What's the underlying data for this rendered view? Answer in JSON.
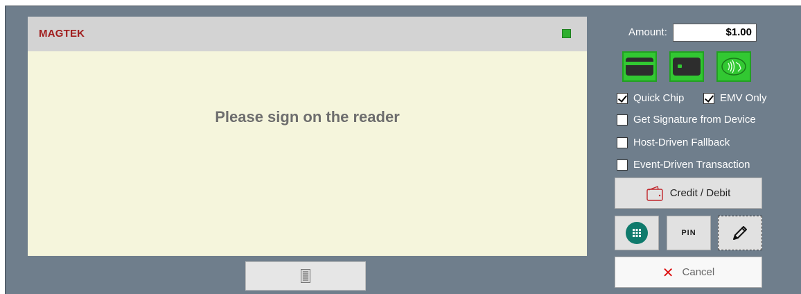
{
  "display": {
    "brand": "MAGTEK",
    "message": "Please sign on the reader",
    "status_color": "#2eaf2e"
  },
  "amount": {
    "label": "Amount:",
    "value": "$1.00"
  },
  "readers": [
    {
      "name": "swipe-card-icon"
    },
    {
      "name": "chip-card-icon"
    },
    {
      "name": "contactless-icon"
    }
  ],
  "options": {
    "quick_chip": {
      "label": "Quick Chip",
      "checked": true
    },
    "emv_only": {
      "label": "EMV Only",
      "checked": true
    },
    "signature": {
      "label": "Get Signature from Device",
      "checked": false
    },
    "host_fallback": {
      "label": "Host-Driven Fallback",
      "checked": false
    },
    "event_driven": {
      "label": "Event-Driven Transaction",
      "checked": false
    }
  },
  "buttons": {
    "credit_debit": "Credit / Debit",
    "pin": "PIN",
    "cancel": "Cancel"
  },
  "colors": {
    "panel": "#6f7e8c",
    "display_bg": "#f5f5dc",
    "brand": "#a01d1d",
    "reader_active": "#32c832",
    "keypad": "#0f7a6c",
    "cancel_x": "#dd1111"
  }
}
